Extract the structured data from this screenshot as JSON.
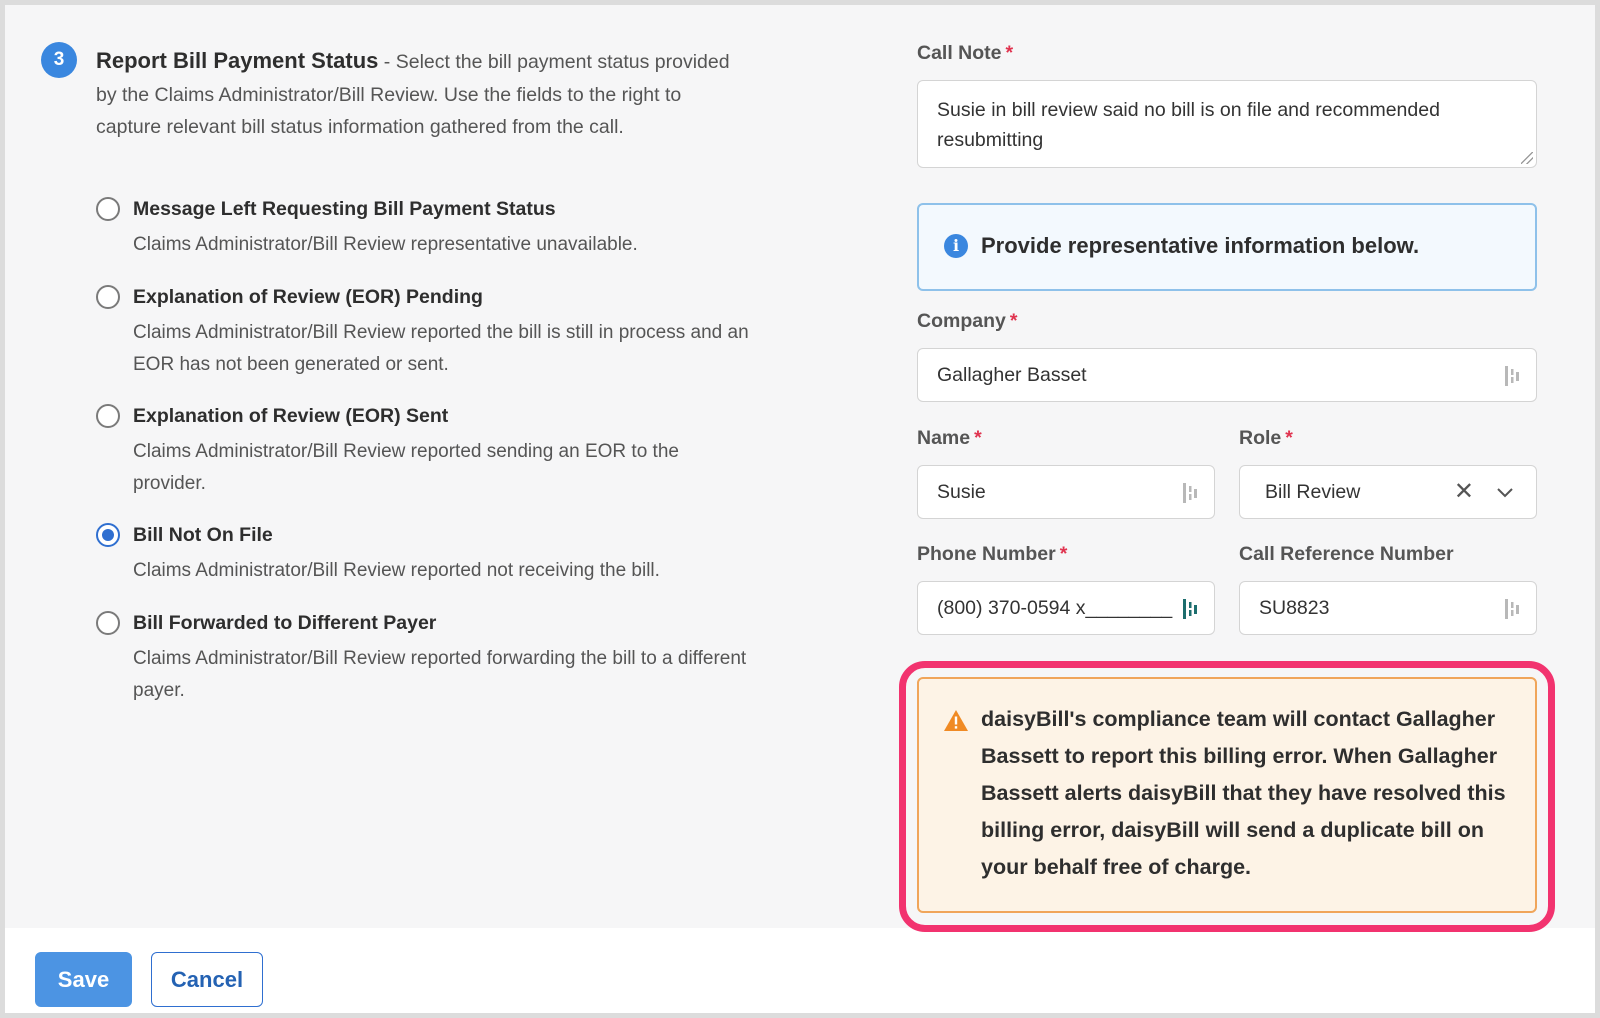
{
  "step": {
    "number": "3",
    "title": "Report Bill Payment Status",
    "description": " - Select the bill payment status provided by the Claims Administrator/Bill Review. Use the fields to the right to capture relevant bill status information gathered from the call."
  },
  "options": [
    {
      "label": "Message Left Requesting Bill Payment Status",
      "desc": "Claims Administrator/Bill Review representative unavailable.",
      "selected": false
    },
    {
      "label": "Explanation of Review (EOR) Pending",
      "desc": "Claims Administrator/Bill Review reported the bill is still in process and an EOR has not been generated or sent.",
      "selected": false
    },
    {
      "label": "Explanation of Review (EOR) Sent",
      "desc": "Claims Administrator/Bill Review reported sending an EOR to the provider.",
      "selected": false
    },
    {
      "label": "Bill Not On File",
      "desc": "Claims Administrator/Bill Review reported not receiving the bill.",
      "selected": true
    },
    {
      "label": "Bill Forwarded to Different Payer",
      "desc": "Claims Administrator/Bill Review reported forwarding the bill to a different payer.",
      "selected": false
    }
  ],
  "call_note": {
    "label": "Call Note",
    "required_mark": "*",
    "value": "Susie in bill review said no bill is on file and recommended resubmitting"
  },
  "info_banner": {
    "icon": "info-icon",
    "text": "Provide representative information below."
  },
  "company": {
    "label": "Company",
    "required_mark": "*",
    "value": "Gallagher Basset"
  },
  "name": {
    "label": "Name",
    "required_mark": "*",
    "value": "Susie"
  },
  "role": {
    "label": "Role",
    "required_mark": "*",
    "value": "Bill Review",
    "clear_glyph": "✕"
  },
  "phone": {
    "label": "Phone Number",
    "required_mark": "*",
    "value": "(800) 370-0594 x________"
  },
  "call_reference": {
    "label": "Call Reference Number",
    "value": "SU8823"
  },
  "warning": {
    "icon": "warning-icon",
    "text": "daisyBill's compliance team will contact Gallagher Bassett to report this billing error. When Gallagher Bassett alerts daisyBill that they have resolved this billing error, daisyBill will send a duplicate bill on your behalf free of charge."
  },
  "footer": {
    "save_label": "Save",
    "cancel_label": "Cancel"
  },
  "colors": {
    "accent": "#3a87df",
    "required": "#e0334f",
    "highlight_outline": "#f2336f",
    "warning_border": "#f0a55a",
    "warning_bg": "#fdf3e6",
    "info_border": "#8ec1ea"
  }
}
